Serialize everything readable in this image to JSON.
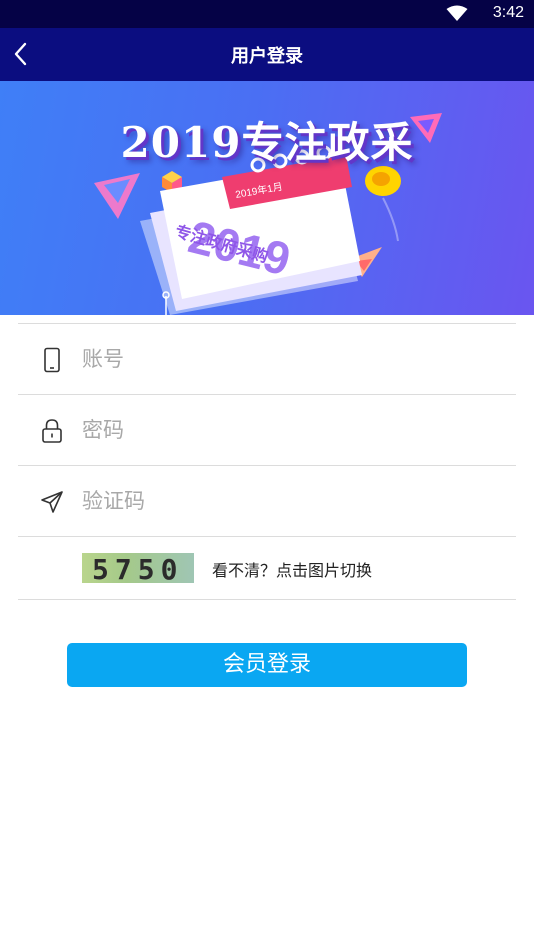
{
  "status_bar": {
    "time": "3:42"
  },
  "nav": {
    "title": "用户登录"
  },
  "banner": {
    "headline": "2019专注政采",
    "calendar_header": "2019年1月",
    "calendar_year": "2019",
    "calendar_caption": "专注政府采购"
  },
  "form": {
    "account_placeholder": "账号",
    "password_placeholder": "密码",
    "captcha_placeholder": "验证码",
    "captcha_code": "5750",
    "captcha_hint": "看不清？点击图片切换"
  },
  "login_button": "会员登录",
  "colors": {
    "status_bar": "#050246",
    "nav_bar": "#0b0d80",
    "button": "#0aa7f2"
  }
}
